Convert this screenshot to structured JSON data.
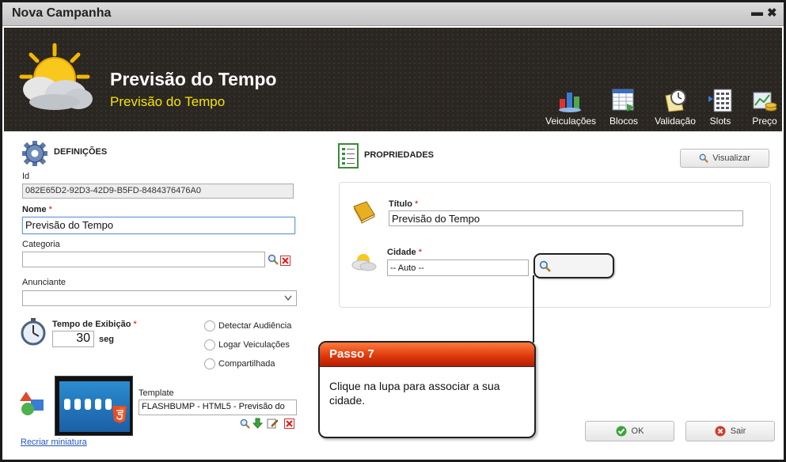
{
  "window": {
    "title": "Nova Campanha",
    "minimize": "▬",
    "close": "✖"
  },
  "header": {
    "title": "Previsão do Tempo",
    "subtitle": "Previsão do Tempo",
    "tools": [
      {
        "label": "Veiculações",
        "icon": "chart-icon"
      },
      {
        "label": "Blocos",
        "icon": "blocks-icon"
      },
      {
        "label": "Validação",
        "icon": "validation-clock-icon"
      },
      {
        "label": "Slots",
        "icon": "slots-icon"
      },
      {
        "label": "Preço",
        "icon": "price-icon"
      }
    ]
  },
  "definitions": {
    "title": "DEFINIÇÕES",
    "id_label": "Id",
    "id_value": "082E65D2-92D3-42D9-B5FD-8484376476A0",
    "name_label": "Nome",
    "name_value": "Previsão do Tempo",
    "category_label": "Categoria",
    "category_value": "",
    "advertiser_label": "Anunciante",
    "advertiser_value": "",
    "display_time_label": "Tempo de Exibição",
    "display_time_value": "30",
    "display_time_unit": "seg",
    "options": [
      "Detectar Audiência",
      "Logar Veiculações",
      "Compartilhada"
    ],
    "template_label": "Template",
    "template_value": "FLASHBUMP - HTML5 - Previsão do",
    "recreate_thumbnail": "Recriar miniatura",
    "required_mark": "*"
  },
  "properties": {
    "title": "PROPRIEDADES",
    "preview_button": "Visualizar",
    "title_label": "Título",
    "title_value": "Previsão do Tempo",
    "city_label": "Cidade",
    "city_value": "-- Auto --"
  },
  "callout": {
    "header": "Passo 7",
    "text": "Clique na lupa para associar a sua cidade."
  },
  "footer": {
    "ok": "OK",
    "exit": "Sair"
  },
  "colors": {
    "accent_yellow": "#f5e400",
    "callout_red": "#e03b0c",
    "header_bg": "#2a2622"
  }
}
